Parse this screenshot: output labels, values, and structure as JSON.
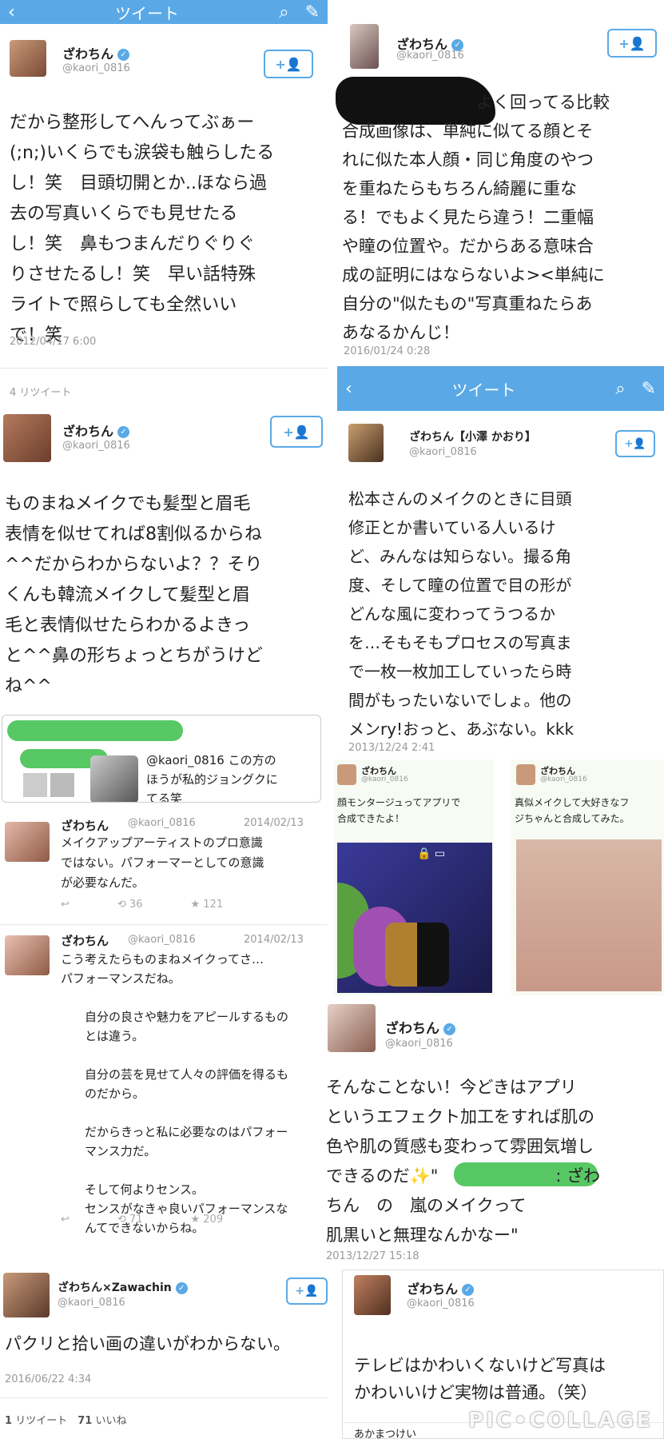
{
  "colors": {
    "accent": "#5aa9e6",
    "green": "#58c865",
    "meta": "#999999"
  },
  "p1": {
    "nav_back": "‹",
    "nav_title": "ツイート",
    "nav_search": "search-icon",
    "nav_compose": "compose-icon",
    "name": "ざわちん",
    "handle": "@kaori_0816",
    "follow": "+👤",
    "text": "だから整形してへんってぶぁー\n(;n;)いくらでも涙袋も触らしたる\nし！笑　目頭切開とか..ほなら過\n去の写真いくらでも見せたる\nし！笑　鼻もつまんだりぐりぐ\nりさせたるし！笑　早い話特殊\nライトで照らしても全然いい\nで！笑",
    "time": "2012/04/17 6:00",
    "retweets": "4 リツイート"
  },
  "p2": {
    "name": "ざわちん",
    "handle": "@kaori_0816",
    "follow": "+👤",
    "text": "ものまねメイクでも髪型と眉毛\n表情を似せてれば8割似るからね\n^^だからわからないよ？？そり\nくんも韓流メイクして髪型と眉\n毛と表情似せたらわかるよきっ\nと^^鼻の形ちょっとちがうけど\nね^^",
    "quote_text": "@kaori_0816 この方の\nほうが私的ジョングクに\nてる笑"
  },
  "p3": {
    "tweets": [
      {
        "name": "ざわちん",
        "handle": "@kaori_0816",
        "date": "2014/02/13",
        "text": "メイクアップアーティストのプロ意識\nではない。パフォーマーとしての意識\nが必要なんだ。",
        "retweets": "36",
        "likes": "121"
      },
      {
        "name": "ざわちん",
        "handle": "@kaori_0816",
        "date": "2014/02/13",
        "text": "こう考えたらものまねメイクってさ…\nパフォーマンスだね。\n\n　　自分の良さや魅力をアピールするもの\n　　とは違う。\n\n　　自分の芸を見せて人々の評価を得るも\n　　のだから。\n\n　　だからきっと私に必要なのはパフォー\n　　マンス力だ。\n\n　　そして何よりセンス。\n　　センスがなきゃ良いパフォーマンスな\n　　んてできないからね。",
        "retweets": "71",
        "likes": "209"
      }
    ]
  },
  "p4": {
    "name": "ざわちん×Zawachin",
    "handle": "@kaori_0816",
    "follow": "+👤",
    "text": "パクリと拾い画の違いがわからない。",
    "time": "2016/06/22 4:34",
    "stats_rt": "1",
    "stats_rt_label": "リツイート",
    "stats_like": "71",
    "stats_like_label": "いいね"
  },
  "p5": {
    "name": "ざわちん",
    "handle": "@kaori_0816",
    "follow": "+👤",
    "text": "よく回ってる比較\n合成画像は、単純に似てる顔とそ\nれに似た本人顔・同じ角度のやつ\nを重ねたらもちろん綺麗に重な\nる！でもよく見たら違う！二重幅\nや瞳の位置や。だからある意味合\n成の証明にはならないよ><単純に\n自分の\"似たもの\"写真重ねたらあ\nあなるかんじ！",
    "time": "2016/01/24 0:28"
  },
  "p6": {
    "nav_back": "‹",
    "nav_title": "ツイート",
    "name": "ざわちん【小澤 かおり】",
    "handle": "@kaori_0816",
    "follow": "+👤",
    "text": "松本さんのメイクのときに目頭\n修正とか書いている人いるけ\nど、みんなは知らない。撮る角\n度、そして瞳の位置で目の形が\nどんな風に変わってうつるか\nを…そもそもプロセスの写真ま\nで一枚一枚加工していったら時\n間がもったいないでしょ。他の\nメンry!おっと、あぶない。kkk",
    "time": "2013/12/24 2:41"
  },
  "p7": {
    "left": {
      "name": "ざわちん",
      "handle": "@kaori_0816",
      "text": "顔モンタージュってアプリで\n合成できたよ！"
    },
    "right": {
      "name": "ざわちん",
      "handle": "@kaori_0816",
      "text": "真似メイクして大好きなフ\nジちゃんと合成してみた。"
    }
  },
  "p8": {
    "name": "ざわちん",
    "handle": "@kaori_0816",
    "text": "そんなことない！今どきはアプリ\nというエフェクト加工をすれば肌の\n色や肌の質感も変わって雰囲気増し\nできるのだ✨\"　　　　　　　: ざわ\nちん　の　嵐のメイクって\n肌黒いと無理なんかなー\"",
    "time": "2013/12/27 15:18"
  },
  "p9": {
    "name": "ざわちん",
    "handle": "@kaori_0816",
    "text": "テレビはかわいくないけど写真は\nかわいいけど実物は普通。（笑）",
    "next_name": "あかまつけい",
    "watermark": "PIC•COLLAGE"
  }
}
